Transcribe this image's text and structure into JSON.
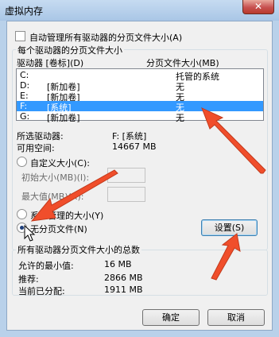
{
  "window": {
    "title": "虚拟内存",
    "close_label": "✕"
  },
  "auto_manage": {
    "label": "自动管理所有驱动器的分页文件大小(A)",
    "checked": false
  },
  "drives_group": {
    "title": "每个驱动器的分页文件大小",
    "col_drive": "驱动器 [卷标](D)",
    "col_size": "分页文件大小(MB)",
    "rows": [
      {
        "drive": "C:",
        "label": "",
        "size": "托管的系统"
      },
      {
        "drive": "D:",
        "label": "[新加卷]",
        "size": "无"
      },
      {
        "drive": "E:",
        "label": "[新加卷]",
        "size": "无"
      },
      {
        "drive": "F:",
        "label": "[系统]",
        "size": "无",
        "selected": true
      },
      {
        "drive": "G:",
        "label": "[新加卷]",
        "size": "无"
      }
    ]
  },
  "selected_drive": {
    "label": "所选驱动器:",
    "value": "F:  [系统]",
    "space_label": "可用空间:",
    "space_value": "14667 MB"
  },
  "options": {
    "custom_label": "自定义大小(C):",
    "initial_label": "初始大小(MB)(I):",
    "max_label": "最大值(MB)(X):",
    "system_managed_label": "系统管理的大小(Y)",
    "no_paging_label": "无分页文件(N)",
    "selected": "no_paging"
  },
  "set_button": "设置(S)",
  "totals_group": {
    "title": "所有驱动器分页文件大小的总数",
    "min_label": "允许的最小值:",
    "min_value": "16 MB",
    "rec_label": "推荐:",
    "rec_value": "2866 MB",
    "cur_label": "当前已分配:",
    "cur_value": "1911 MB"
  },
  "ok_button": "确定",
  "cancel_button": "取消",
  "colors": {
    "selection": "#3399ff",
    "arrow": "#f04e2b"
  }
}
